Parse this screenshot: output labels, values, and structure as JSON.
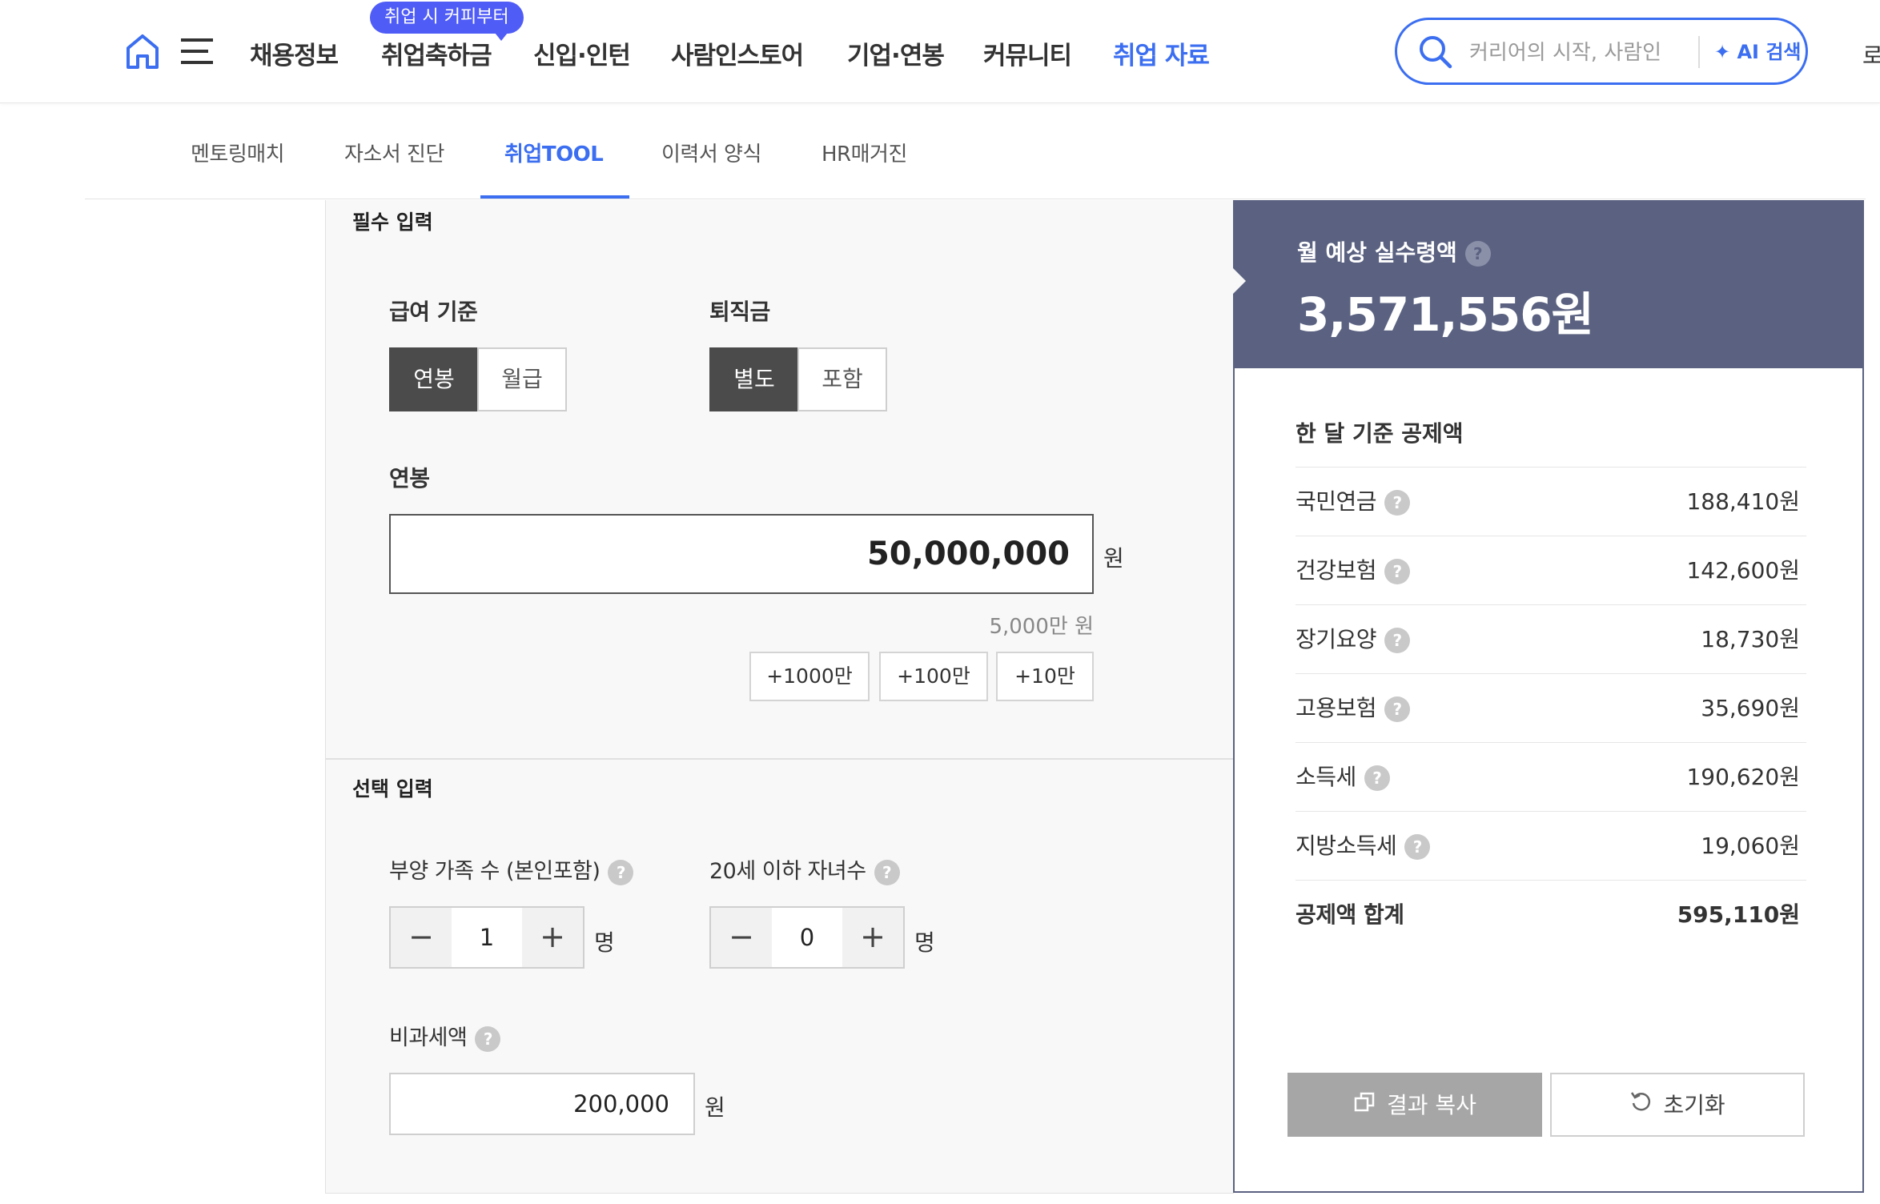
{
  "header": {
    "promo_badge": "취업 시 커피부터",
    "nav": [
      "채용정보",
      "취업축하금",
      "신입·인턴",
      "사람인스토어",
      "기업·연봉",
      "커뮤니티",
      "취업 자료"
    ],
    "search_placeholder": "커리어의 시작, 사람인",
    "ai_search_label": "AI 검색",
    "edge_text": "로"
  },
  "subnav": [
    "멘토링매치",
    "자소서 진단",
    "취업TOOL",
    "이력서 양식",
    "HR매거진"
  ],
  "required": {
    "title": "필수 입력",
    "pay_basis_label": "급여 기준",
    "pay_basis_options": [
      "연봉",
      "월급"
    ],
    "severance_label": "퇴직금",
    "severance_options": [
      "별도",
      "포함"
    ],
    "salary_label": "연봉",
    "salary_value": "50,000,000",
    "unit_won": "원",
    "salary_hint": "5,000만 원",
    "quick_add": [
      "+1000만",
      "+100만",
      "+10만"
    ]
  },
  "optional": {
    "title": "선택 입력",
    "dependents_label": "부양 가족 수 (본인포함)",
    "dependents_value": "1",
    "children_label": "20세 이하 자녀수",
    "children_value": "0",
    "person_unit": "명",
    "nontax_label": "비과세액",
    "nontax_value": "200,000",
    "unit_won": "원",
    "minus": "−",
    "plus": "+",
    "help": "?"
  },
  "result": {
    "net_title": "월 예상 실수령액",
    "net_amount": "3,571,556원",
    "deduction_title": "한 달 기준 공제액",
    "deductions": [
      {
        "name": "국민연금",
        "value": "188,410원"
      },
      {
        "name": "건강보험",
        "value": "142,600원"
      },
      {
        "name": "장기요양",
        "value": "18,730원"
      },
      {
        "name": "고용보험",
        "value": "35,690원"
      },
      {
        "name": "소득세",
        "value": "190,620원"
      },
      {
        "name": "지방소득세",
        "value": "19,060원"
      }
    ],
    "total_label": "공제액 합계",
    "total_value": "595,110원",
    "copy_label": "결과 복사",
    "reset_label": "초기화"
  },
  "colors": {
    "accent": "#3b6ef0",
    "badge": "#4f5cf6",
    "result_header": "#5b6281",
    "toggle_on": "#4b4b4b"
  }
}
